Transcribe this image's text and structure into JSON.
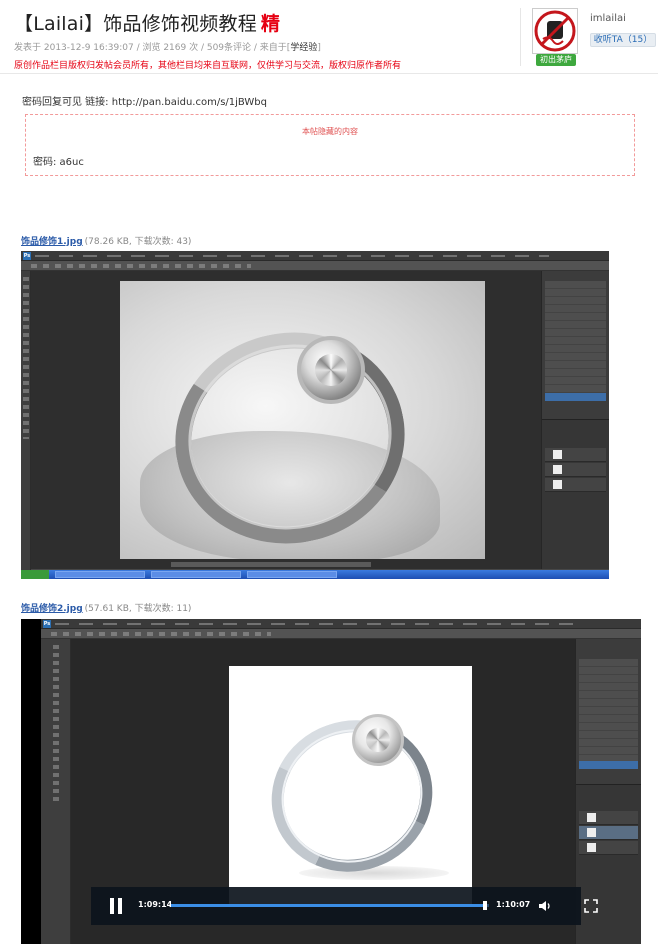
{
  "post": {
    "title": "【Lailai】饰品修饰视频教程",
    "elite_badge": "精",
    "meta_prefix": "发表于 2013-12-9 16:39:07 / 浏览 2169 次 / 509条评论 / 来自于[",
    "meta_source": "学经验",
    "meta_suffix": "]",
    "copyright_notice": "原创作品栏目版权归发帖会员所有，其他栏目均来自互联网，仅供学习与交流，版权归原作者所有"
  },
  "author": {
    "username": "imlailai",
    "level_badge": "初出茅庐",
    "follow_label": "收听TA（15）"
  },
  "content": {
    "reply_line": "密码回复可见 链接: http://pan.baidu.com/s/1jBWbq",
    "hidden_box_title": "本帖隐藏的内容",
    "password_line": "密码: a6uc"
  },
  "attachments": [
    {
      "filename": "饰品修饰1.jpg",
      "info": "(78.26 KB, 下载次数: 43)"
    },
    {
      "filename": "饰品修饰2.jpg",
      "info": "(57.61 KB, 下载次数: 11)"
    }
  ],
  "video_player": {
    "current_time": "1:09:14",
    "total_time": "1:10:07",
    "progress_fraction": 0.987
  },
  "colors": {
    "accent_red": "#e60012",
    "link_blue": "#2a5aa8",
    "badge_green": "#3ea83e"
  },
  "icons": {
    "avatar": "fist-logo-icon",
    "play": "pause-icon",
    "volume": "speaker-icon",
    "fullscreen": "fullscreen-icon"
  }
}
